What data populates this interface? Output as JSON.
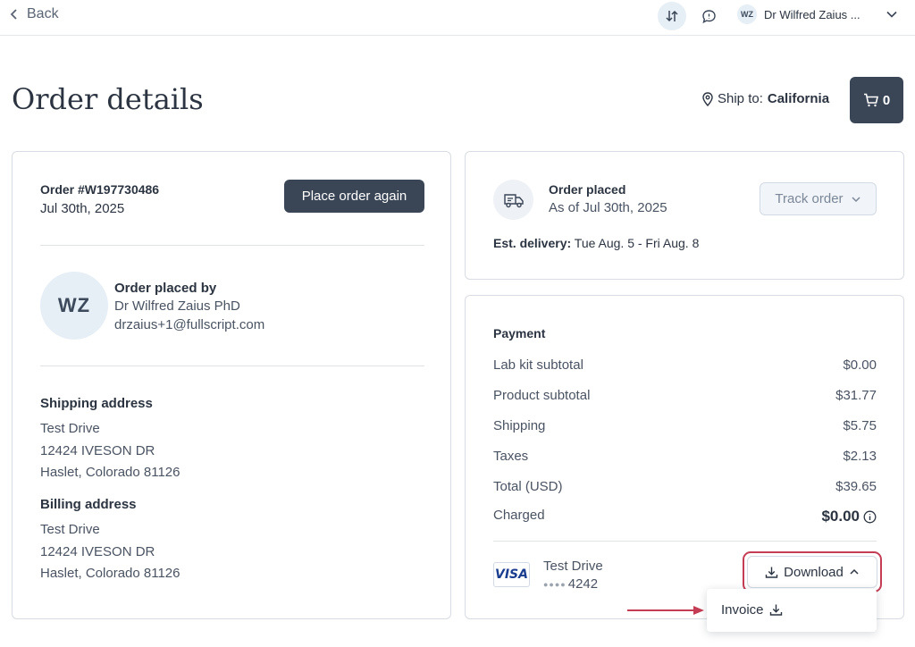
{
  "topbar": {
    "back_label": "Back",
    "user_initials": "WZ",
    "user_name": "Dr Wilfred Zaius ..."
  },
  "header": {
    "title": "Order details",
    "ship_to_label": "Ship to:",
    "ship_to_value": "California",
    "cart_count": "0"
  },
  "order": {
    "number": "Order #W197730486",
    "date": "Jul 30th, 2025",
    "place_again_label": "Place order again",
    "placed_by_heading": "Order placed by",
    "placed_by_initials": "WZ",
    "placed_by_name": "Dr Wilfred Zaius PhD",
    "placed_by_email": "drzaius+1@fullscript.com"
  },
  "shipping": {
    "heading": "Shipping address",
    "lines": [
      "Test Drive",
      "12424 IVESON DR",
      "Haslet, Colorado 81126"
    ]
  },
  "billing": {
    "heading": "Billing address",
    "lines": [
      "Test Drive",
      "12424 IVESON DR",
      "Haslet, Colorado 81126"
    ]
  },
  "status": {
    "heading": "Order placed",
    "sub": "As of Jul 30th, 2025",
    "track_label": "Track order",
    "est_label": "Est. delivery:",
    "est_value": "Tue Aug. 5 - Fri Aug. 8"
  },
  "payment": {
    "heading": "Payment",
    "rows": [
      {
        "label": "Lab kit subtotal",
        "amount": "$0.00"
      },
      {
        "label": "Product subtotal",
        "amount": "$31.77"
      },
      {
        "label": "Shipping",
        "amount": "$5.75"
      },
      {
        "label": "Taxes",
        "amount": "$2.13"
      },
      {
        "label": "Total (USD)",
        "amount": "$39.65"
      },
      {
        "label": "Charged",
        "amount": "$0.00"
      }
    ],
    "card_brand": "VISA",
    "card_holder": "Test Drive",
    "card_last4": "4242",
    "download_label": "Download",
    "menu_items": [
      "Invoice"
    ]
  },
  "colors": {
    "dark_button": "#3a4556",
    "highlight": "#c43d55"
  }
}
